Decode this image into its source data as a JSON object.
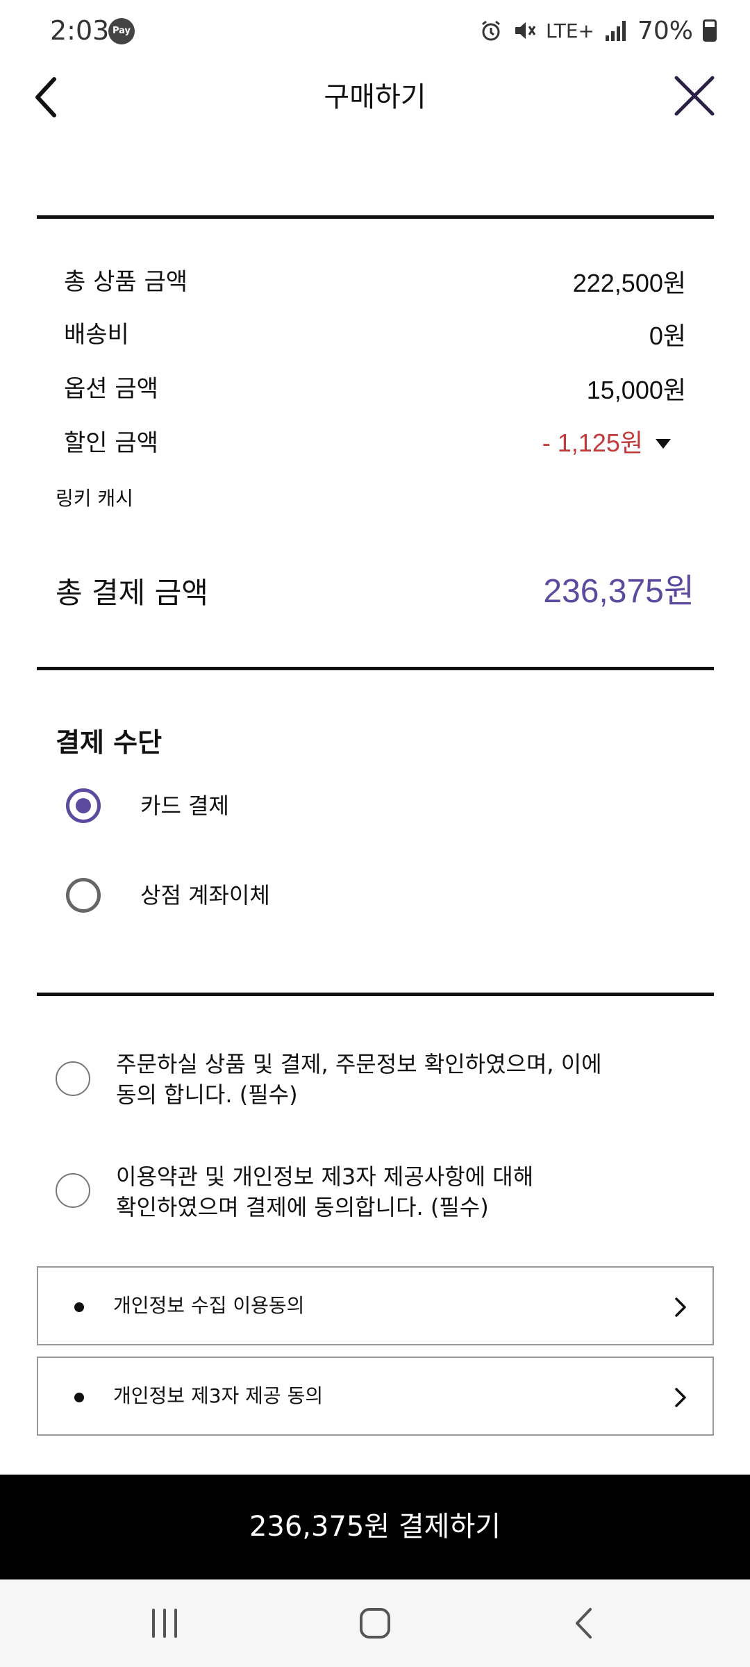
{
  "status_bar": {
    "time": "2:03",
    "pay_badge": "Pay",
    "network": "LTE+",
    "battery": "70%",
    "icons": [
      "alarm-icon",
      "mute-icon",
      "lte-icon",
      "signal-icon",
      "battery-icon"
    ]
  },
  "header": {
    "title": "구매하기",
    "back_icon": "back-arrow-icon",
    "close_icon": "close-icon"
  },
  "summary": {
    "items": [
      {
        "label": "총 상품 금액",
        "value": "222,500원"
      },
      {
        "label": "배송비",
        "value": "0원"
      },
      {
        "label": "옵션 금액",
        "value": "15,000원"
      },
      {
        "label": "할인 금액",
        "value": "- 1,125원"
      }
    ],
    "linki_cash_label": "링키 캐시",
    "total_label": "총 결제 금액",
    "total_value": "236,375원"
  },
  "payment": {
    "title": "결제 수단",
    "options": [
      {
        "label": "카드 결제",
        "selected": true
      },
      {
        "label": "상점 계좌이체",
        "selected": false
      }
    ]
  },
  "agreements": [
    {
      "line1": "주문하실 상품 및 결제, 주문정보 확인하였으며, 이에",
      "line2": "동의 합니다. (필수)"
    },
    {
      "line1": "이용약관 및 개인정보 제3자 제공사항에 대해",
      "line2": "확인하였으며 결제에 동의합니다. (필수)"
    }
  ],
  "policy_rows": [
    {
      "label": "개인정보 수집 이용동의"
    },
    {
      "label": "개인정보 제3자 제공 동의"
    }
  ],
  "cta": {
    "label": "236,375원 결제하기"
  },
  "colors": {
    "accent": "#5c4a9e",
    "discount": "#c23a3a",
    "cta_background": "#000000"
  },
  "nav_bar": {
    "icons": [
      "recent-apps-icon",
      "home-icon",
      "back-icon"
    ]
  }
}
